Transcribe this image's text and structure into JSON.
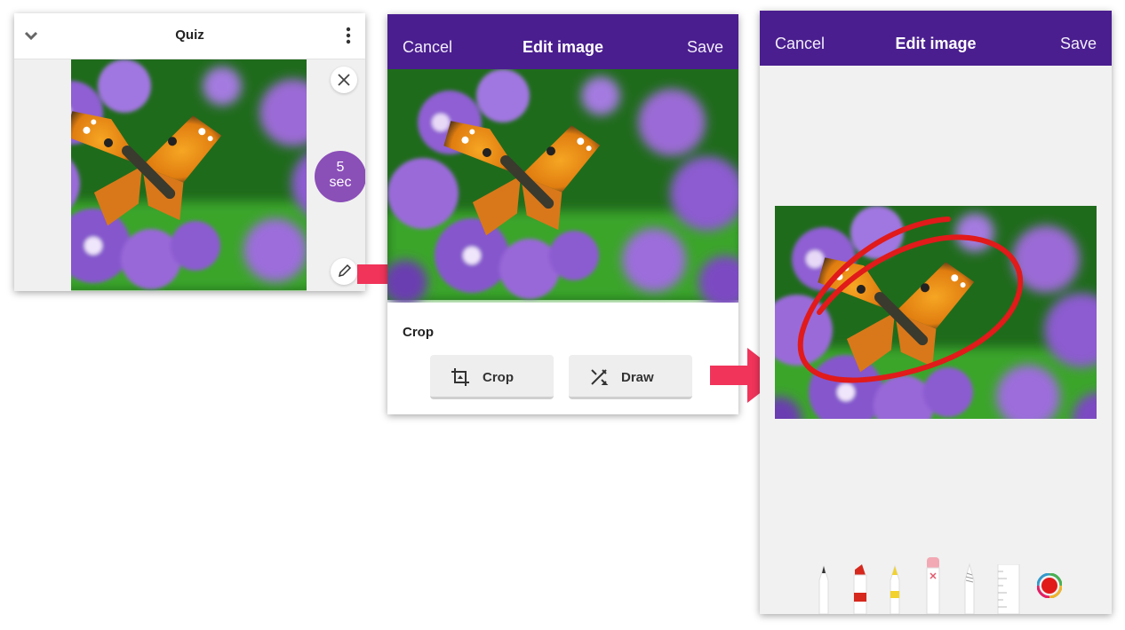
{
  "quiz_panel": {
    "title": "Quiz",
    "timer_value": "5",
    "timer_unit": "sec",
    "collapse_icon": "chevron-down-icon",
    "menu_icon": "vertical-dots-icon",
    "close_icon": "close-icon",
    "edit_icon": "pencil-icon"
  },
  "edit_panel": {
    "cancel_label": "Cancel",
    "title": "Edit image",
    "save_label": "Save",
    "section_label": "Crop",
    "buttons": [
      {
        "label": "Crop",
        "icon": "crop-icon"
      },
      {
        "label": "Draw",
        "icon": "draw-tools-icon"
      }
    ]
  },
  "draw_panel": {
    "cancel_label": "Cancel",
    "title": "Edit image",
    "save_label": "Save",
    "tools": [
      "pen",
      "marker",
      "highlighter",
      "eraser",
      "pencil",
      "ruler",
      "color-picker"
    ]
  },
  "colors": {
    "header_purple": "#4a1e8f",
    "timer_purple": "#8b4fb8",
    "arrow_red": "#f0345a",
    "annotation_red": "#e11a1a"
  }
}
